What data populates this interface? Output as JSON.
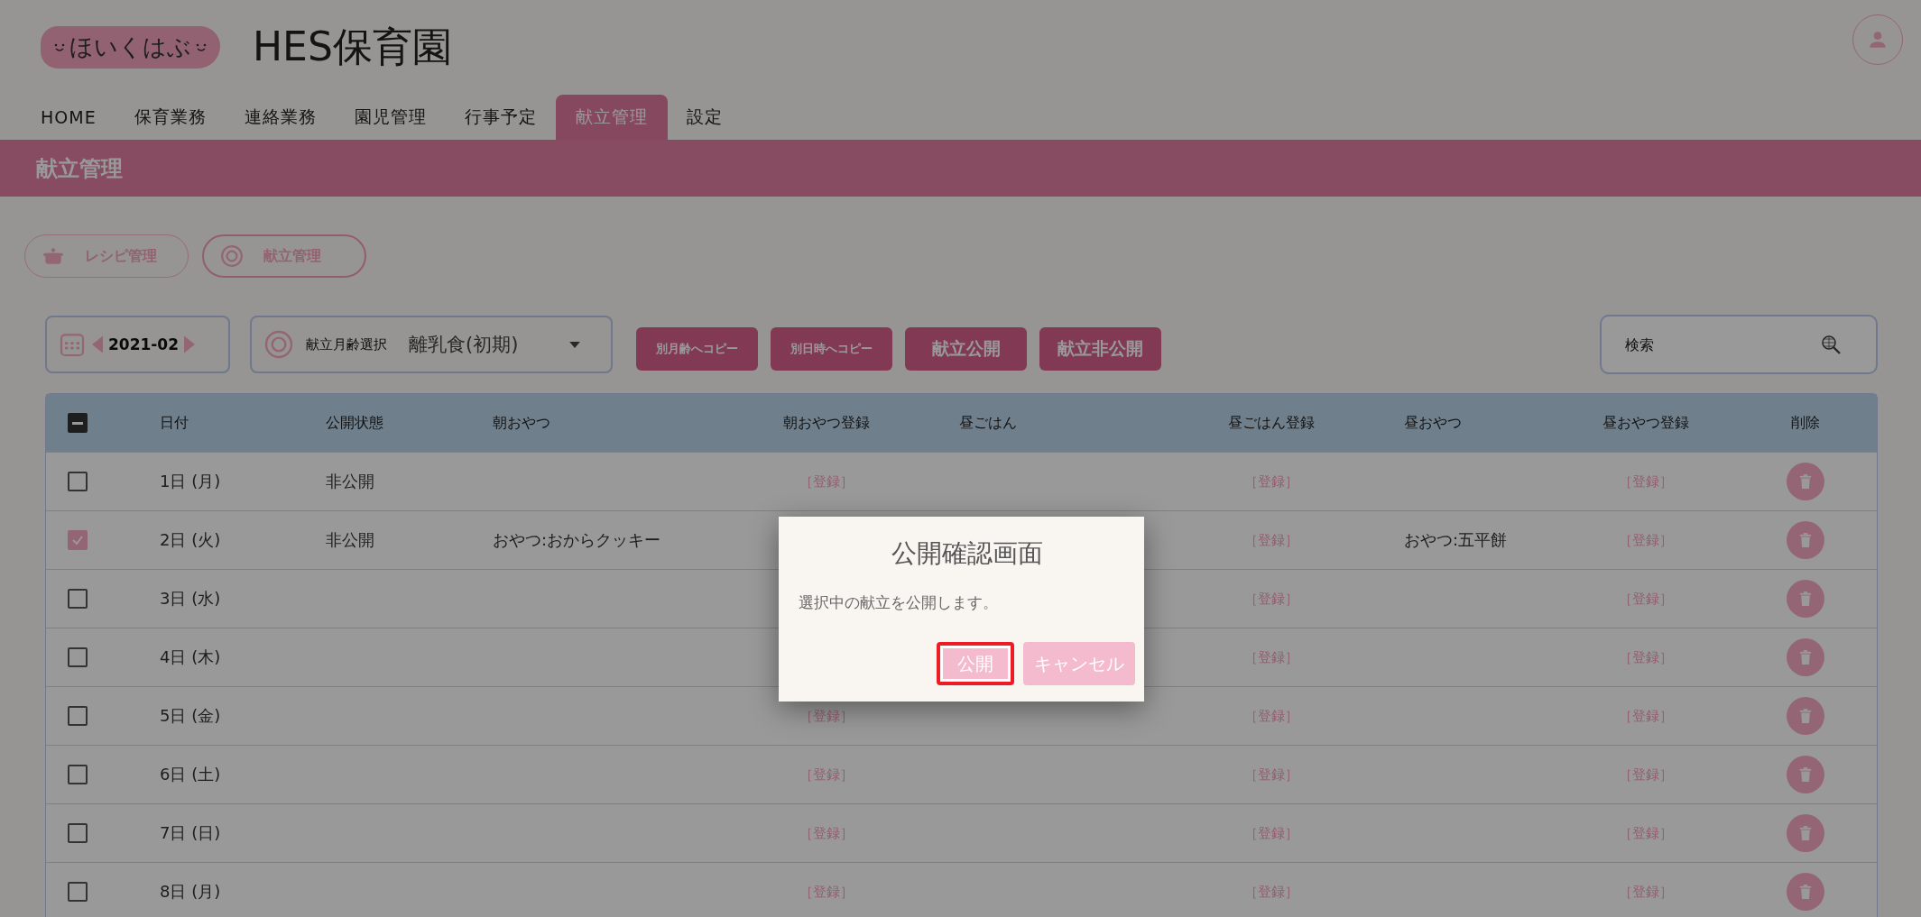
{
  "header": {
    "logo_text": "ほいくはぶ",
    "title": "HES保育園"
  },
  "nav": [
    {
      "label": "HOME",
      "selected": false
    },
    {
      "label": "保育業務",
      "selected": false
    },
    {
      "label": "連絡業務",
      "selected": false
    },
    {
      "label": "園児管理",
      "selected": false
    },
    {
      "label": "行事予定",
      "selected": false
    },
    {
      "label": "献立管理",
      "selected": true
    },
    {
      "label": "設定",
      "selected": false
    }
  ],
  "banner": {
    "title": "献立管理"
  },
  "sub_tabs": [
    {
      "label": "レシピ管理",
      "kind": "pot",
      "selected": false
    },
    {
      "label": "献立管理",
      "kind": "plate",
      "selected": true
    }
  ],
  "toolbar": {
    "month": "2021-02",
    "age_select": {
      "label": "献立月齢選択",
      "value": "離乳食(初期)"
    },
    "buttons": [
      {
        "label": "別月齢へコピー",
        "kind": "small"
      },
      {
        "label": "別日時へコピー",
        "kind": "small"
      },
      {
        "label": "献立公開",
        "kind": "large"
      },
      {
        "label": "献立非公開",
        "kind": "large"
      }
    ],
    "search": {
      "placeholder": "検索"
    }
  },
  "table": {
    "select_all": {
      "indeterminate": true
    },
    "columns": [
      "日付",
      "公開状態",
      "朝おやつ",
      "朝おやつ登録",
      "昼ごはん",
      "昼ごはん登録",
      "昼おやつ",
      "昼おやつ登録",
      "削除"
    ],
    "rows": [
      {
        "checked": false,
        "date": "1日 (月)",
        "status": "非公開",
        "morning_register": "［登録］",
        "lunch_register": "［登録］",
        "afternoon_register": "［登録］"
      },
      {
        "checked": true,
        "date": "2日 (火)",
        "status": "非公開",
        "morning_snack": "おやつ:おからクッキー",
        "lunch_register": "［登録］",
        "afternoon_snack": "おやつ:五平餅",
        "afternoon_register": "［登録］"
      },
      {
        "checked": false,
        "date": "3日 (水)",
        "lunch_register": "［登録］",
        "afternoon_register": "［登録］"
      },
      {
        "checked": false,
        "date": "4日 (木)",
        "lunch_register": "［登録］",
        "afternoon_register": "［登録］"
      },
      {
        "checked": false,
        "date": "5日 (金)",
        "morning_register": "［登録］",
        "lunch_register": "［登録］",
        "afternoon_register": "［登録］"
      },
      {
        "checked": false,
        "date": "6日 (土)",
        "morning_register": "［登録］",
        "lunch_register": "［登録］",
        "afternoon_register": "［登録］"
      },
      {
        "checked": false,
        "date": "7日 (日)",
        "morning_register": "［登録］",
        "lunch_register": "［登録］",
        "afternoon_register": "［登録］"
      },
      {
        "checked": false,
        "date": "8日 (月)",
        "morning_register": "［登録］",
        "lunch_register": "［登録］",
        "afternoon_register": "［登録］"
      }
    ]
  },
  "dialog": {
    "title": "公開確認画面",
    "message": "選択中の献立を公開します。",
    "buttons": [
      {
        "label": "公開",
        "focused": true
      },
      {
        "label": "キャンセル",
        "focused": false
      }
    ]
  }
}
